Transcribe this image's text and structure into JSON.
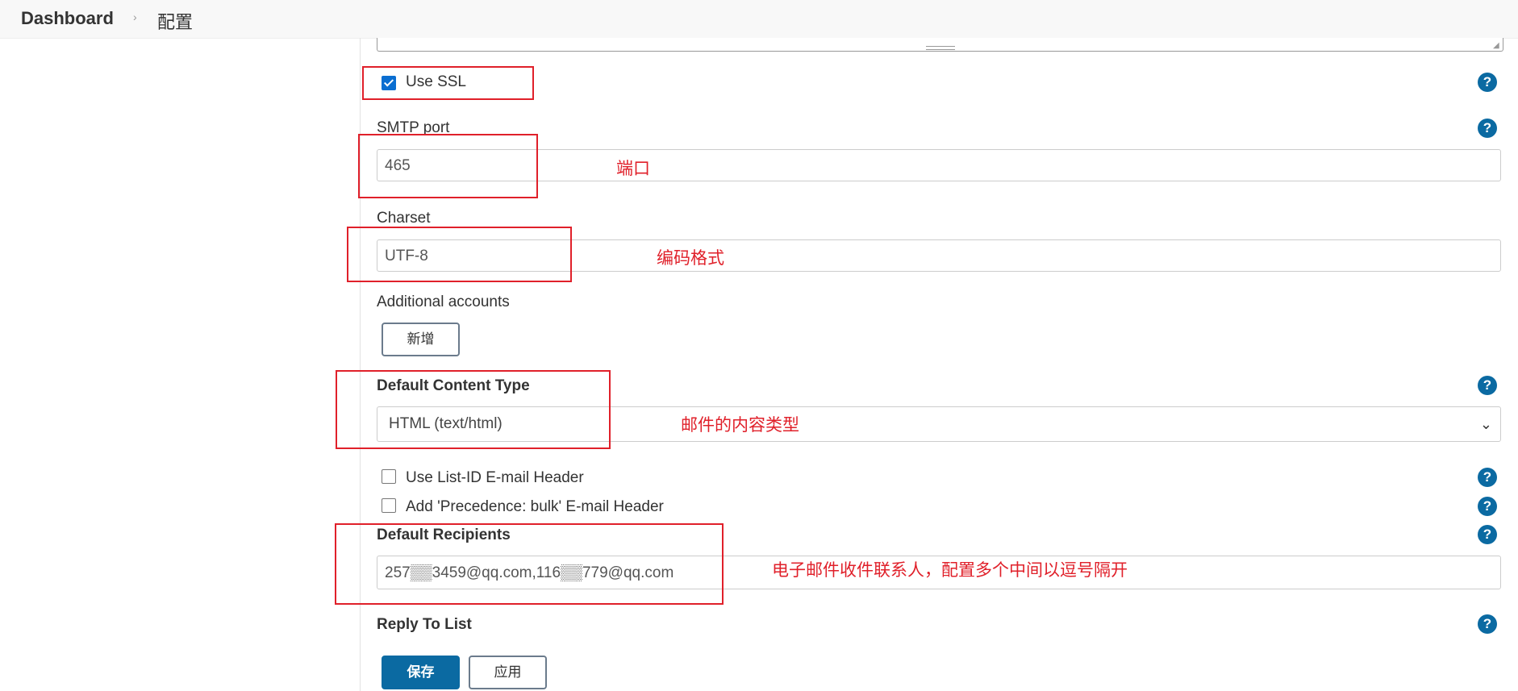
{
  "breadcrumb": {
    "home": "Dashboard",
    "separator": "›",
    "current": "配置"
  },
  "use_ssl": {
    "label": "Use SSL",
    "checked": true
  },
  "smtp_port": {
    "label": "SMTP port",
    "value": "465",
    "annotation": "端口"
  },
  "charset": {
    "label": "Charset",
    "value": "UTF-8",
    "annotation": "编码格式"
  },
  "additional_accounts": {
    "label": "Additional accounts",
    "add_button": "新增"
  },
  "default_content_type": {
    "label": "Default Content Type",
    "selected": "HTML (text/html)",
    "caret": "⌄",
    "annotation": "邮件的内容类型"
  },
  "list_id_header": {
    "label": "Use List-ID E-mail Header",
    "checked": false
  },
  "precedence_header": {
    "label": "Add 'Precedence: bulk' E-mail Header",
    "checked": false
  },
  "default_recipients": {
    "label": "Default Recipients",
    "value": "257▒▒3459@qq.com,116▒▒779@qq.com",
    "annotation": "电子邮件收件联系人，配置多个中间以逗号隔开"
  },
  "reply_to_list": {
    "label": "Reply To List"
  },
  "help_glyph": "?",
  "actions": {
    "save": "保存",
    "apply": "应用"
  },
  "colors": {
    "accent": "#0b6aa2",
    "annotation": "#e0202a"
  },
  "icons": [
    "help-icon",
    "checkbox-icon",
    "chevron-down-icon",
    "resize-grip-icon"
  ]
}
